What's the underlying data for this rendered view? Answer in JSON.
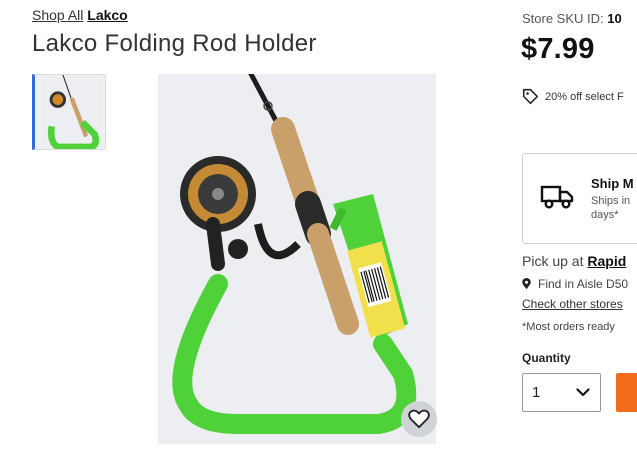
{
  "breadcrumb": {
    "prefix": "Shop All",
    "brand": "Lakco"
  },
  "product": {
    "title": "Lakco Folding Rod Holder"
  },
  "sku": {
    "label": "Store SKU ID:",
    "value": "10"
  },
  "price": "$7.99",
  "promo": {
    "text": "20% off select F",
    "icon": "tag-icon"
  },
  "shipping": {
    "title": "Ship M",
    "subtitle": "Ships in days*",
    "icon": "truck-icon"
  },
  "pickup": {
    "prefix": "Pick up at",
    "store": "Rapid"
  },
  "aisle": {
    "text": "Find in Aisle D50",
    "icon": "location-pin-icon"
  },
  "check_stores": "Check other stores",
  "note": "*Most orders ready",
  "quantity": {
    "label": "Quantity",
    "selected": "1"
  },
  "colors": {
    "accent": "#f26a1b",
    "thumb_active": "#2e6fd1",
    "holder_green": "#4fd13a"
  }
}
